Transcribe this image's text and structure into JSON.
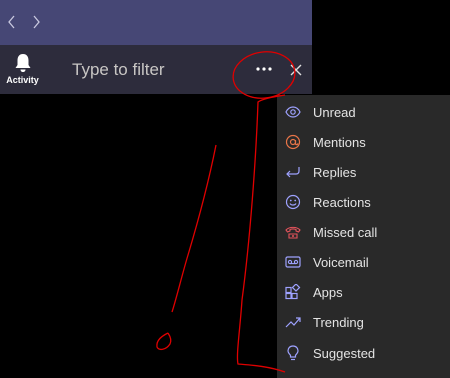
{
  "nav": {
    "back_icon": "chevron-left-icon",
    "forward_icon": "chevron-right-icon"
  },
  "rail": {
    "activity_label": "Activity",
    "icon": "bell-icon"
  },
  "filter": {
    "placeholder": "Type to filter",
    "value": ""
  },
  "menu": {
    "items": [
      {
        "label": "Unread",
        "icon": "eye-icon",
        "icon_color": "#9ea2ff"
      },
      {
        "label": "Mentions",
        "icon": "at-icon",
        "icon_color": "#e97548"
      },
      {
        "label": "Replies",
        "icon": "reply-icon",
        "icon_color": "#9ea2ff"
      },
      {
        "label": "Reactions",
        "icon": "smile-icon",
        "icon_color": "#9ea2ff"
      },
      {
        "label": "Missed call",
        "icon": "phone-icon",
        "icon_color": "#e5535c"
      },
      {
        "label": "Voicemail",
        "icon": "voicemail-icon",
        "icon_color": "#9ea2ff"
      },
      {
        "label": "Apps",
        "icon": "apps-icon",
        "icon_color": "#9ea2ff"
      },
      {
        "label": "Trending",
        "icon": "trending-icon",
        "icon_color": "#9ea2ff"
      },
      {
        "label": "Suggested",
        "icon": "lightbulb-icon",
        "icon_color": "#9ea2ff"
      }
    ]
  },
  "colors": {
    "accent": "#464775",
    "panel": "#2d2c3c",
    "menu_bg": "#292929",
    "annotation": "#e00000"
  }
}
